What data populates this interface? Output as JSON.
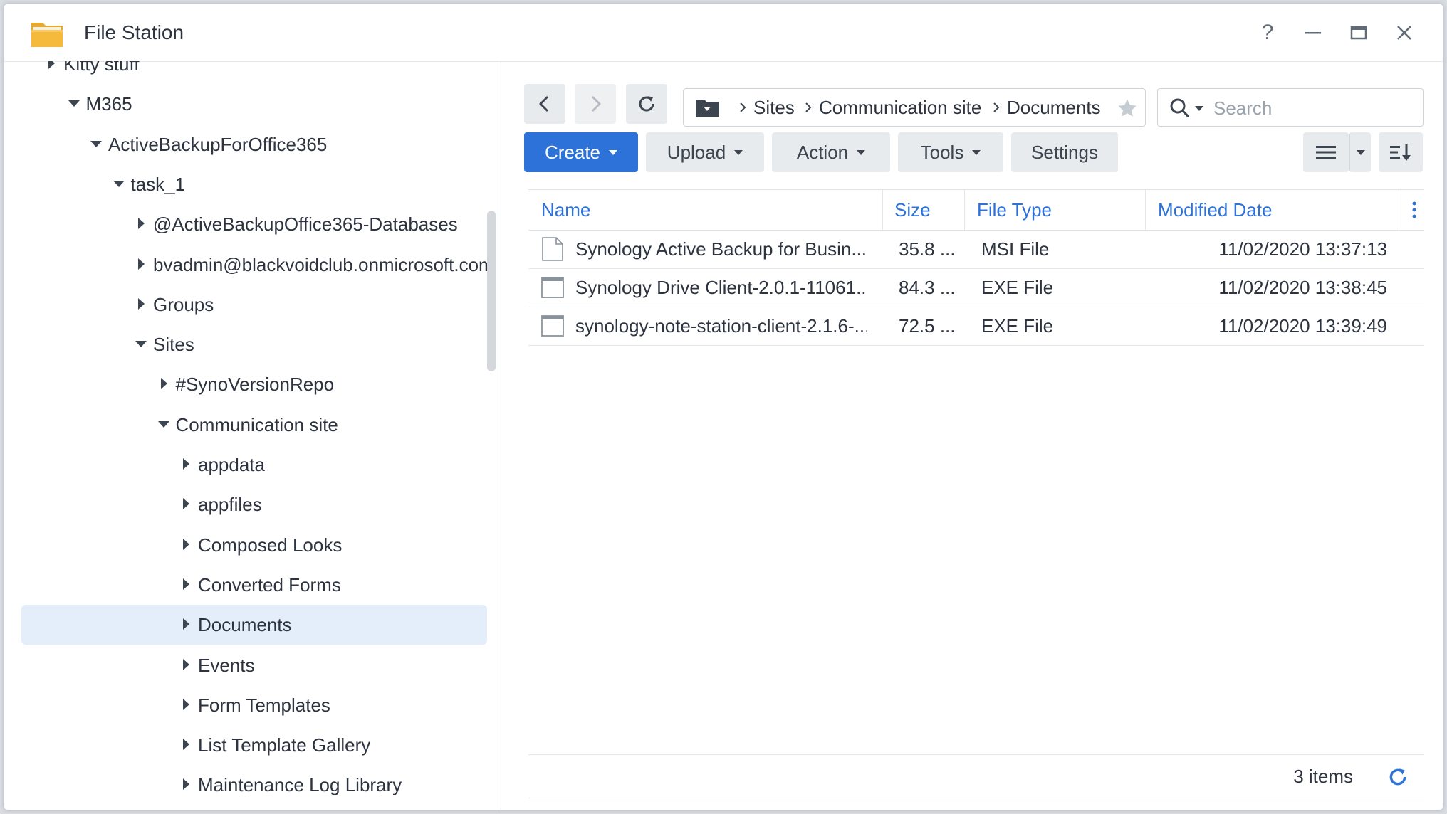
{
  "window": {
    "title": "File Station",
    "help_label": "?"
  },
  "tree": {
    "items": [
      {
        "label": "Kitty stuff",
        "state": "collapsed"
      },
      {
        "label": "M365",
        "state": "expanded"
      },
      {
        "label": "ActiveBackupForOffice365",
        "state": "expanded"
      },
      {
        "label": "task_1",
        "state": "expanded"
      },
      {
        "label": "@ActiveBackupOffice365-Databases",
        "state": "collapsed"
      },
      {
        "label": "bvadmin@blackvoidclub.onmicrosoft.com",
        "state": "collapsed"
      },
      {
        "label": "Groups",
        "state": "collapsed"
      },
      {
        "label": "Sites",
        "state": "expanded"
      },
      {
        "label": "#SynoVersionRepo",
        "state": "collapsed"
      },
      {
        "label": "Communication site",
        "state": "expanded"
      },
      {
        "label": "appdata",
        "state": "collapsed"
      },
      {
        "label": "appfiles",
        "state": "collapsed"
      },
      {
        "label": "Composed Looks",
        "state": "collapsed"
      },
      {
        "label": "Converted Forms",
        "state": "collapsed"
      },
      {
        "label": "Documents",
        "state": "collapsed",
        "selected": true
      },
      {
        "label": "Events",
        "state": "collapsed"
      },
      {
        "label": "Form Templates",
        "state": "collapsed"
      },
      {
        "label": "List Template Gallery",
        "state": "collapsed"
      },
      {
        "label": "Maintenance Log Library",
        "state": "collapsed"
      }
    ]
  },
  "nav": {
    "back_icon": "chevron-left-icon",
    "forward_icon": "chevron-right-icon",
    "refresh_icon": "refresh-icon"
  },
  "path": {
    "crumbs": [
      "Sites",
      "Communication site",
      "Documents"
    ]
  },
  "search": {
    "placeholder": "Search"
  },
  "toolbar": {
    "create_label": "Create",
    "upload_label": "Upload",
    "action_label": "Action",
    "tools_label": "Tools",
    "settings_label": "Settings"
  },
  "table": {
    "columns": [
      "Name",
      "Size",
      "File Type",
      "Modified Date"
    ],
    "rows": [
      {
        "name": "Synology Active Backup for Busin...",
        "size": "35.8 ...",
        "type": "MSI File",
        "modified": "11/02/2020 13:37:13",
        "icon": "document-icon"
      },
      {
        "name": "Synology Drive Client-2.0.1-11061....",
        "size": "84.3 ...",
        "type": "EXE File",
        "modified": "11/02/2020 13:38:45",
        "icon": "window-icon"
      },
      {
        "name": "synology-note-station-client-2.1.6-...",
        "size": "72.5 ...",
        "type": "EXE File",
        "modified": "11/02/2020 13:39:49",
        "icon": "window-icon"
      }
    ]
  },
  "footer": {
    "count_label": "3 items"
  },
  "colors": {
    "accent": "#2d72d9",
    "selected_bg": "#e4edfa",
    "button_bg": "#e8ebee",
    "text": "#2d3440"
  }
}
